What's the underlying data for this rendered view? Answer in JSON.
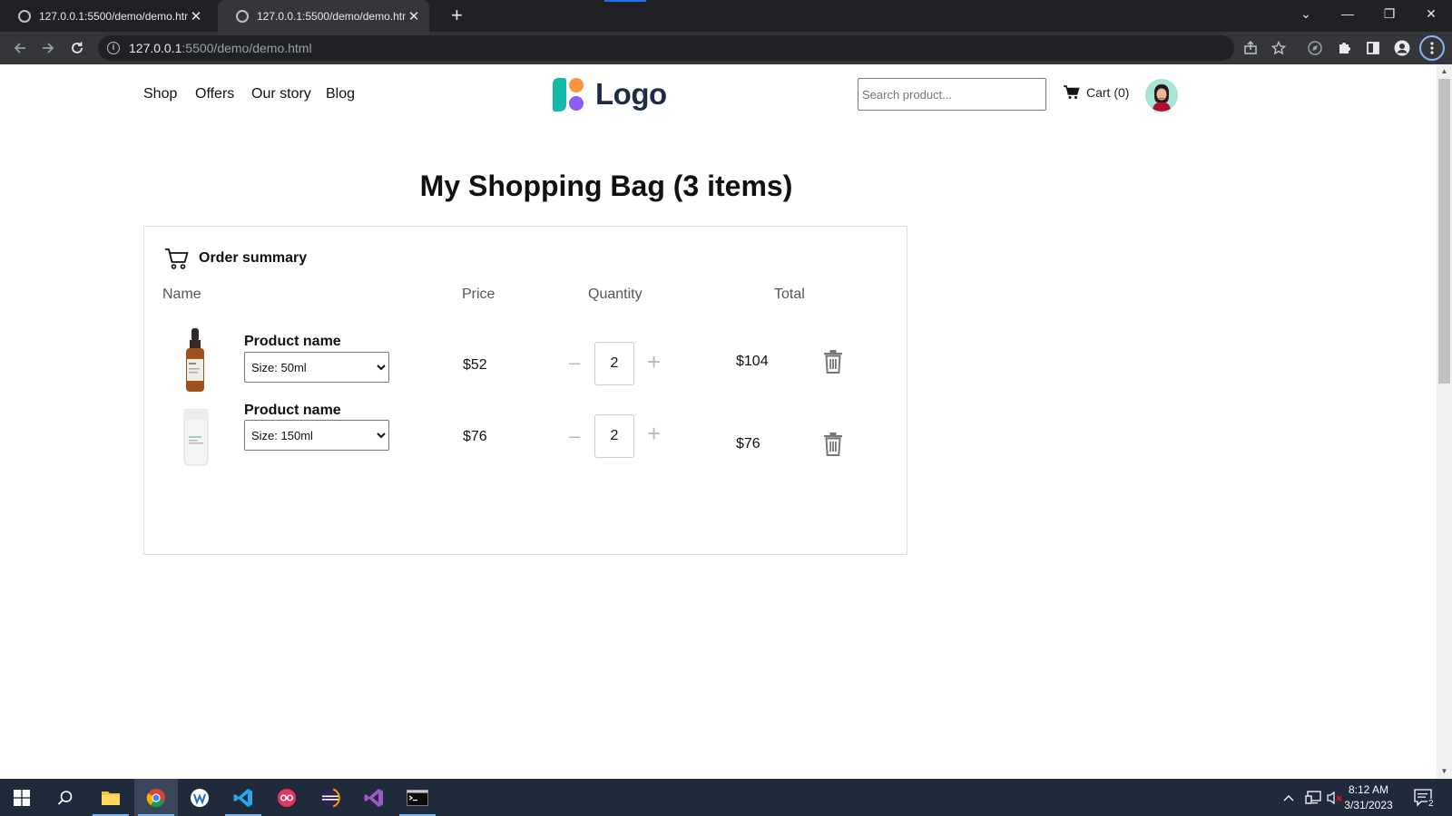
{
  "browser": {
    "tabs": [
      {
        "title": "127.0.0.1:5500/demo/demo.html",
        "close": "✕"
      },
      {
        "title": "127.0.0.1:5500/demo/demo.html",
        "close": "✕"
      }
    ],
    "new_tab": "+",
    "window_controls": {
      "dropdown": "⌄",
      "minimize": "—",
      "restore": "❐",
      "close": "✕"
    },
    "url_host": "127.0.0.1",
    "url_rest": ":5500/demo/demo.html"
  },
  "site": {
    "nav": [
      "Shop",
      "Offers",
      "Our story",
      "Blog"
    ],
    "logo_text": "Logo",
    "search_placeholder": "Search product...",
    "cart_label": "Cart (0)"
  },
  "bag": {
    "title": "My Shopping Bag (3 items)",
    "summary_label": "Order summary",
    "columns": {
      "name": "Name",
      "price": "Price",
      "quantity": "Quantity",
      "total": "Total"
    },
    "items": [
      {
        "name": "Product name",
        "size": "Size: 50ml",
        "price": "$52",
        "quantity": "2",
        "total": "$104",
        "minus": "–",
        "plus": "+"
      },
      {
        "name": "Product name",
        "size": "Size: 150ml",
        "price": "$76",
        "quantity": "2",
        "total": "$76",
        "minus": "–",
        "plus": "+"
      }
    ]
  },
  "taskbar": {
    "time": "8:12 AM",
    "date": "3/31/2023",
    "notifications": "2"
  },
  "colors": {
    "chrome_dark": "#202124",
    "chrome_toolbar": "#35363a",
    "taskbar": "#1f2a3a",
    "logo_teal": "#14b8a6",
    "logo_orange": "#fb923c",
    "logo_purple": "#8b5cf6"
  }
}
